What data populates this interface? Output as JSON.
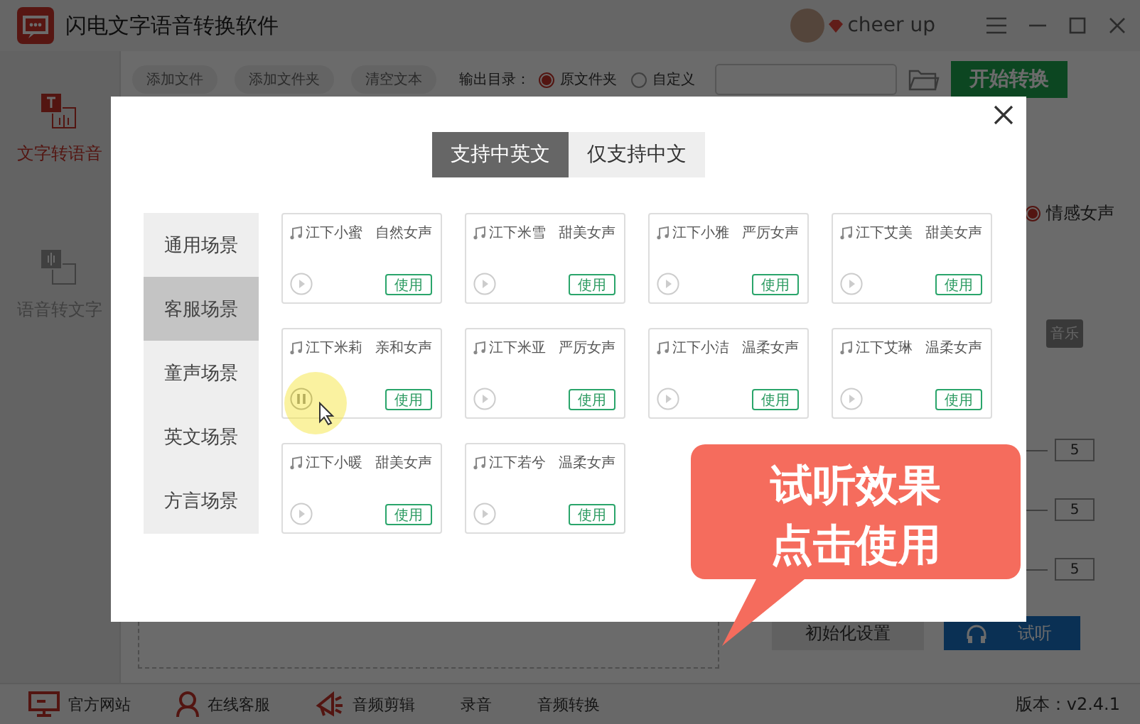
{
  "window": {
    "title": "闪电文字语音转换软件",
    "user": "cheer up"
  },
  "sidebar": [
    {
      "label": "文字转语音",
      "kind": "tts",
      "selected": true
    },
    {
      "label": "语音转文字",
      "kind": "stt",
      "selected": false
    }
  ],
  "toolbar": {
    "buttons": [
      "添加文件",
      "添加文件夹",
      "清空文本"
    ],
    "output_label": "输出目录：",
    "output_options": [
      {
        "label": "原文件夹",
        "selected": true
      },
      {
        "label": "自定义",
        "selected": false
      }
    ],
    "start_button": "开始转换"
  },
  "settings": {
    "voice_option": {
      "label": "情感女声",
      "selected": true
    },
    "tag": "音乐",
    "fields": [
      "5",
      "5",
      "5"
    ],
    "buttons": [
      {
        "label": "初始化设置",
        "kind": "secondary"
      },
      {
        "label": "试听",
        "kind": "primary"
      }
    ]
  },
  "footer": {
    "links": [
      {
        "label": "官方网站",
        "kind": "monitor"
      },
      {
        "label": "在线客服",
        "kind": "person"
      },
      {
        "label": "音频剪辑",
        "kind": "horn"
      },
      {
        "label": "录音",
        "kind": "text"
      },
      {
        "label": "音频转换",
        "kind": "text"
      }
    ],
    "version": "版本：v2.4.1"
  },
  "dialog": {
    "tabs": [
      {
        "label": "支持中英文",
        "selected": true
      },
      {
        "label": "仅支持中文",
        "selected": false
      }
    ],
    "categories": [
      {
        "label": "通用场景",
        "selected": false
      },
      {
        "label": "客服场景",
        "selected": true
      },
      {
        "label": "童声场景",
        "selected": false
      },
      {
        "label": "英文场景",
        "selected": false
      },
      {
        "label": "方言场景",
        "selected": false
      }
    ],
    "voices": [
      {
        "name": "江下小蜜",
        "style": "自然女声",
        "playing": false,
        "button": "使用"
      },
      {
        "name": "江下米雪",
        "style": "甜美女声",
        "playing": false,
        "button": "使用"
      },
      {
        "name": "江下小雅",
        "style": "严厉女声",
        "playing": false,
        "button": "使用"
      },
      {
        "name": "江下艾美",
        "style": "甜美女声",
        "playing": false,
        "button": "使用"
      },
      {
        "name": "江下米莉",
        "style": "亲和女声",
        "playing": true,
        "button": "使用"
      },
      {
        "name": "江下米亚",
        "style": "严厉女声",
        "playing": false,
        "button": "使用"
      },
      {
        "name": "江下小洁",
        "style": "温柔女声",
        "playing": false,
        "button": "使用"
      },
      {
        "name": "江下艾琳",
        "style": "温柔女声",
        "playing": false,
        "button": "使用"
      },
      {
        "name": "江下小暖",
        "style": "甜美女声",
        "playing": false,
        "button": "使用"
      },
      {
        "name": "江下若兮",
        "style": "温柔女声",
        "playing": false,
        "button": "使用"
      }
    ]
  },
  "callout": {
    "lines": [
      "试听效果",
      "点击使用"
    ]
  }
}
